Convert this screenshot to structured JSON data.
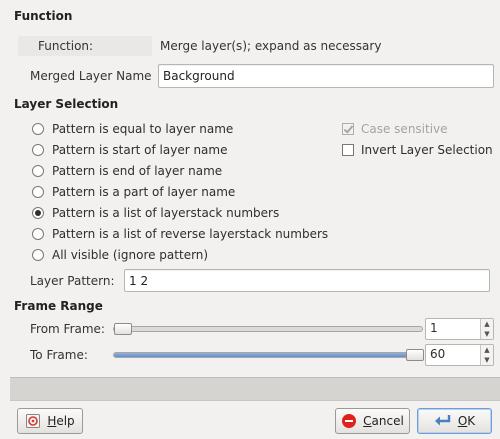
{
  "function_section": {
    "title": "Function",
    "label": "Function:",
    "value": "Merge layer(s); expand as necessary"
  },
  "merged_layer": {
    "label": "Merged Layer Name",
    "value": "Background"
  },
  "layer_selection": {
    "title": "Layer Selection",
    "options": [
      {
        "label": "Pattern is equal to layer name",
        "selected": false
      },
      {
        "label": "Pattern is start of layer name",
        "selected": false
      },
      {
        "label": "Pattern is end of layer name",
        "selected": false
      },
      {
        "label": "Pattern is a part of layer name",
        "selected": false
      },
      {
        "label": "Pattern is a list of layerstack numbers",
        "selected": true
      },
      {
        "label": "Pattern is a list of reverse layerstack numbers",
        "selected": false
      },
      {
        "label": "All visible (ignore pattern)",
        "selected": false
      }
    ],
    "case_sensitive": {
      "label": "Case sensitive",
      "checked": true,
      "disabled": true
    },
    "invert_selection": {
      "label": "Invert Layer Selection",
      "checked": false
    },
    "pattern_label": "Layer Pattern:",
    "pattern_value": "1 2"
  },
  "frame_range": {
    "title": "Frame Range",
    "from_label": "From Frame:",
    "from_value": "1",
    "to_label": "To Frame:",
    "to_value": "60",
    "from_fraction": 0.0,
    "to_fraction": 1.0
  },
  "buttons": {
    "help_label": "Help",
    "help_mnemonic": "H",
    "cancel_label": "Cancel",
    "cancel_mnemonic": "C",
    "ok_label": "OK",
    "ok_mnemonic": "O"
  },
  "icons": {
    "help": "help-icon",
    "cancel": "cancel-icon",
    "ok": "ok-icon",
    "spin_up": "spin-up-icon",
    "spin_down": "spin-down-icon"
  },
  "colors": {
    "slider_fill": "#5f8fce",
    "cancel_icon": "#e0201b",
    "ok_icon": "#4a7fc4"
  }
}
